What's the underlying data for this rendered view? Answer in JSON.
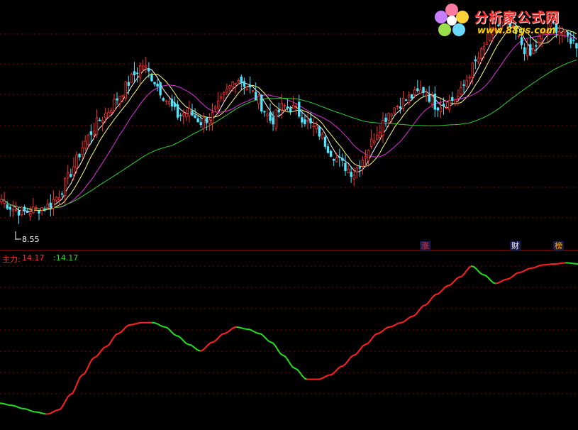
{
  "logo": {
    "title": "分析家公式网",
    "url": "www.88gs.com"
  },
  "main_panel": {
    "low_price_label": "8.55"
  },
  "badges": [
    "涨",
    "财",
    "榜"
  ],
  "indicator": {
    "name_label": "主力:",
    "value": "14.17",
    "value2": ":14.17",
    "up_color": "#ff2020",
    "down_color": "#22dd22"
  },
  "colors": {
    "up_candle": "#ff3030",
    "down_candle": "#4fe6ff",
    "ma_short": "#ffffff",
    "ma_mid": "#ffff80",
    "ma_long": "#e030e0",
    "ma_slow": "#30d030",
    "grid": "#7a0000",
    "divider": "#cc0000"
  },
  "chart_data": [
    {
      "type": "candlestick",
      "title": "",
      "price_range": [
        7.9,
        15.2
      ],
      "annotated_low": 8.55,
      "close_path": [
        9.2,
        8.9,
        8.8,
        8.9,
        9.0,
        9.4,
        10.1,
        10.9,
        11.5,
        11.9,
        12.4,
        12.9,
        13.4,
        12.9,
        12.3,
        11.8,
        11.9,
        11.6,
        11.8,
        12.4,
        13.0,
        12.7,
        12.2,
        11.6,
        12.1,
        12.0,
        11.6,
        11.3,
        10.7,
        10.3,
        10.0,
        10.6,
        11.3,
        11.9,
        12.2,
        12.4,
        12.6,
        12.1,
        12.2,
        12.4,
        13.2,
        13.8,
        14.5,
        14.7,
        14.2,
        13.6,
        14.3,
        14.6,
        14.3,
        14.0
      ],
      "moving_averages": [
        {
          "name": "",
          "color": "#ffffff"
        },
        {
          "name": "",
          "color": "#ffff80"
        },
        {
          "name": "",
          "color": "#e030e0"
        },
        {
          "name": "",
          "color": "#30d030"
        }
      ]
    },
    {
      "type": "line",
      "title": "主力",
      "last_value": 14.17,
      "ylim": [
        7.5,
        14.9
      ],
      "values": [
        8.6,
        8.5,
        8.35,
        8.2,
        8.1,
        8.3,
        9.0,
        9.9,
        10.7,
        11.2,
        11.8,
        12.2,
        12.3,
        12.3,
        12.1,
        11.7,
        11.3,
        11.0,
        11.4,
        11.8,
        12.1,
        12.0,
        11.8,
        11.4,
        10.8,
        10.2,
        9.7,
        9.7,
        9.9,
        10.3,
        10.8,
        11.3,
        11.8,
        12.1,
        12.3,
        12.6,
        13.1,
        13.6,
        14.0,
        14.4,
        14.9,
        14.5,
        14.1,
        14.3,
        14.6,
        14.8,
        14.95,
        15.0,
        15.05,
        15.0
      ]
    }
  ]
}
